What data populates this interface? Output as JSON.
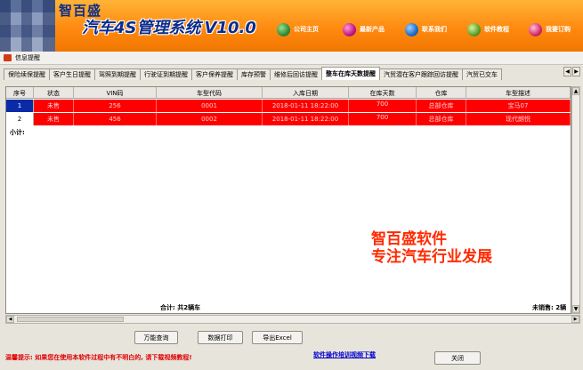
{
  "header": {
    "brand_small": "智百盛",
    "brand_main": "汽车4S管理系统",
    "version": "V10.0",
    "nav": [
      {
        "label": "公司主页",
        "icon": "home-icon",
        "color": "#2f8d3a"
      },
      {
        "label": "最新产品",
        "icon": "product-icon",
        "color": "#c0158a"
      },
      {
        "label": "联系我们",
        "icon": "contact-icon",
        "color": "#1b6cc9"
      },
      {
        "label": "软件教程",
        "icon": "tutorial-icon",
        "color": "#5aa02c"
      },
      {
        "label": "我要订购",
        "icon": "order-icon",
        "color": "#d62a6a"
      }
    ]
  },
  "window": {
    "title": "信息提醒"
  },
  "tabs": [
    {
      "label": "保险续保提醒",
      "active": false
    },
    {
      "label": "客户生日提醒",
      "active": false
    },
    {
      "label": "驾照到期提醒",
      "active": false
    },
    {
      "label": "行驶证到期提醒",
      "active": false
    },
    {
      "label": "客户保养提醒",
      "active": false
    },
    {
      "label": "库存预警",
      "active": false
    },
    {
      "label": "维修后回访提醒",
      "active": false
    },
    {
      "label": "整车在库天数提醒",
      "active": true
    },
    {
      "label": "汽贸潜在客户跟踪回访提醒",
      "active": false
    },
    {
      "label": "汽贸已交车",
      "active": false
    }
  ],
  "table": {
    "columns": [
      "序号",
      "状态",
      "VIN码",
      "车型代码",
      "入库日期",
      "在库天数",
      "仓库",
      "车型描述"
    ],
    "rows": [
      {
        "no": "1",
        "status": "未售",
        "vin": "256",
        "model_code": "0001",
        "date": "2018-01-11 18:22:00",
        "days": "700",
        "warehouse": "总部仓库",
        "desc": "宝马07"
      },
      {
        "no": "2",
        "status": "未售",
        "vin": "456",
        "model_code": "0002",
        "date": "2018-01-11 18:22:00",
        "days": "700",
        "warehouse": "总部仓库",
        "desc": "现代朗悦"
      }
    ],
    "subtotal_label": "小计:",
    "total_label": "合计: 共2辆车",
    "unsold_label": "未销售: 2辆"
  },
  "promo": {
    "line1": "智百盛软件",
    "line2": "专注汽车行业发展"
  },
  "buttons": {
    "query": "万能查询",
    "print": "数据打印",
    "export": "导出Excel",
    "close": "关闭"
  },
  "footer": {
    "hint": "温馨提示: 如果您在使用本软件过程中有不明白的, 请下载视频教程!",
    "video_link": "软件操作培训视频下载"
  }
}
